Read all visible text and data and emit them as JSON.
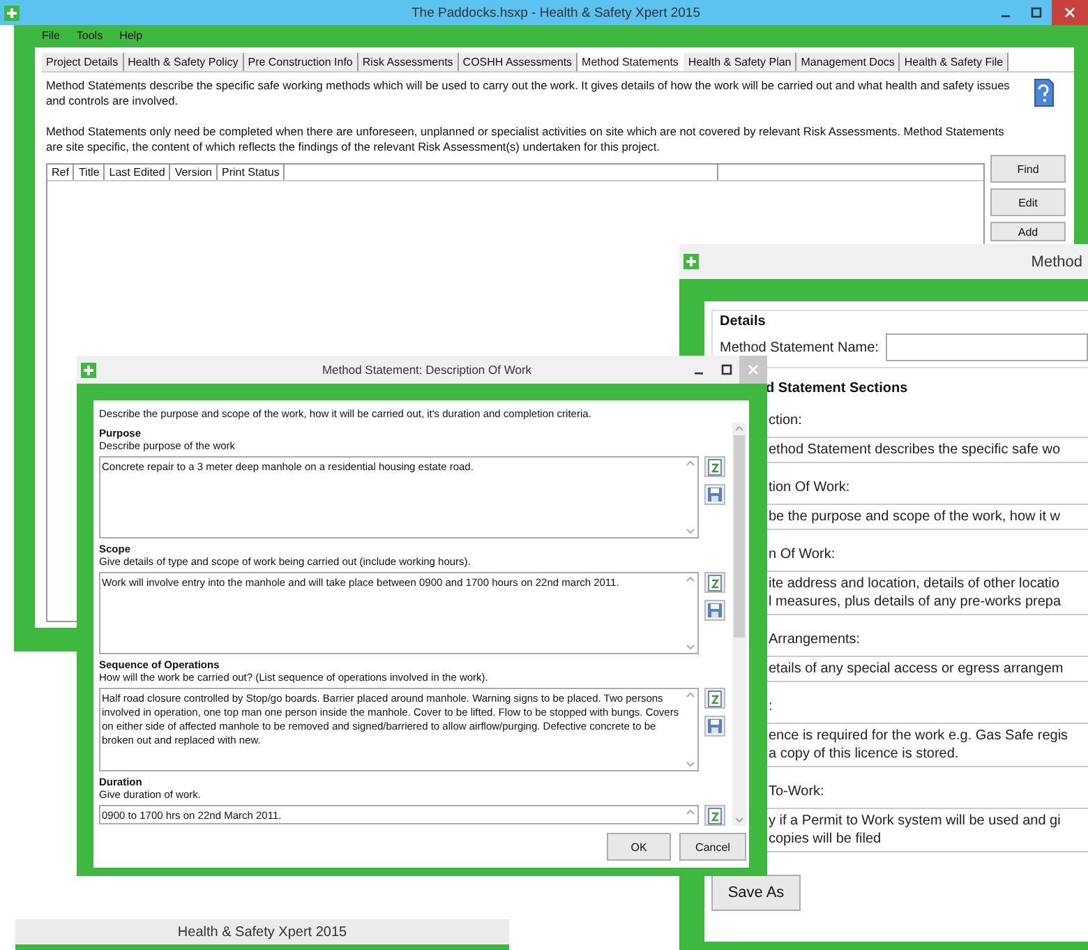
{
  "main_window": {
    "title": "The Paddocks.hsxp - Health & Safety Xpert 2015",
    "menu": [
      "File",
      "Tools",
      "Help"
    ],
    "tabs": [
      {
        "label": "Project Details",
        "selected": false
      },
      {
        "label": "Health & Safety Policy",
        "selected": false
      },
      {
        "label": "Pre Construction Info",
        "selected": false
      },
      {
        "label": "Risk Assessments",
        "selected": false
      },
      {
        "label": "COSHH Assessments",
        "selected": false
      },
      {
        "label": "Method Statements",
        "selected": true
      },
      {
        "label": "Health & Safety Plan",
        "selected": false
      },
      {
        "label": "Management Docs",
        "selected": false
      },
      {
        "label": "Health & Safety File",
        "selected": false
      }
    ],
    "paragraphs": [
      "Method Statements describe the specific safe working methods which will be used to carry out the work. It gives details of how the work will be carried out and what health and safety issues and controls are involved.",
      "Method Statements only need be completed when there are unforeseen, unplanned or specialist activities on site which are not covered by relevant Risk Assessments. Method Statements are site specific, the content of which reflects the findings of the relevant Risk Assessment(s) undertaken for this project."
    ],
    "table": {
      "columns": [
        "Ref",
        "Title",
        "Last Edited",
        "Version",
        "Print Status"
      ]
    },
    "buttons": [
      "Find",
      "Edit",
      "Add"
    ]
  },
  "details_window": {
    "title": "Method",
    "details_heading": "Details",
    "name_label": "Method Statement Name:",
    "sections_heading": "d Statement Sections",
    "sections": [
      {
        "label": "ction:",
        "lines": [
          "ethod Statement describes the specific safe wo"
        ]
      },
      {
        "label": "tion Of Work:",
        "lines": [
          "be the purpose and scope of the work, how it w"
        ]
      },
      {
        "label": "n Of Work:",
        "lines": [
          "ite address and location, details of other locatio",
          "l measures, plus details of any pre-works prepa"
        ]
      },
      {
        "label": "Arrangements:",
        "lines": [
          "etails of any special access or egress arrangem"
        ]
      },
      {
        "label": ":",
        "lines": [
          "ence is required for the work e.g. Gas Safe regis",
          "a copy of this licence is stored."
        ]
      },
      {
        "label": "To-Work:",
        "lines": [
          "y if a Permit to Work system will be used and gi",
          "copies will be filed"
        ]
      }
    ],
    "save_button": "Save As"
  },
  "dialog": {
    "title": "Method Statement: Description Of Work",
    "intro": "Describe the purpose and scope of the work, how it will be carried out, it's duration and completion criteria.",
    "sections": [
      {
        "heading": "Purpose",
        "hint": "Describe purpose of the work",
        "value": "Concrete repair to a 3 meter deep manhole on a residential housing estate road."
      },
      {
        "heading": "Scope",
        "hint": "Give details of type and scope of work being carried out (include working hours).",
        "value": "Work will involve entry into the manhole and will take place between 0900 and 1700 hours on  22nd march 2011."
      },
      {
        "heading": "Sequence of Operations",
        "hint": "How will the work be carried out? (List sequence of operations involved in the work).",
        "value": "Half road closure controlled by Stop/go boards. Barrier placed around manhole. Warning signs to be placed. Two persons involved in operation, one top man one person inside the manhole. Cover to be lifted. Flow to be stopped with bungs.  Covers on either side of affected manhole to be removed and signed/barriered to allow airflow/purging. Defective concrete to be broken out and replaced with new."
      },
      {
        "heading": "Duration",
        "hint": "Give duration of work.",
        "value": "0900 to 1700 hrs on 22nd March 2011."
      }
    ],
    "buttons": [
      "OK",
      "Cancel"
    ]
  },
  "background_window": {
    "title": "Health & Safety Xpert 2015"
  }
}
